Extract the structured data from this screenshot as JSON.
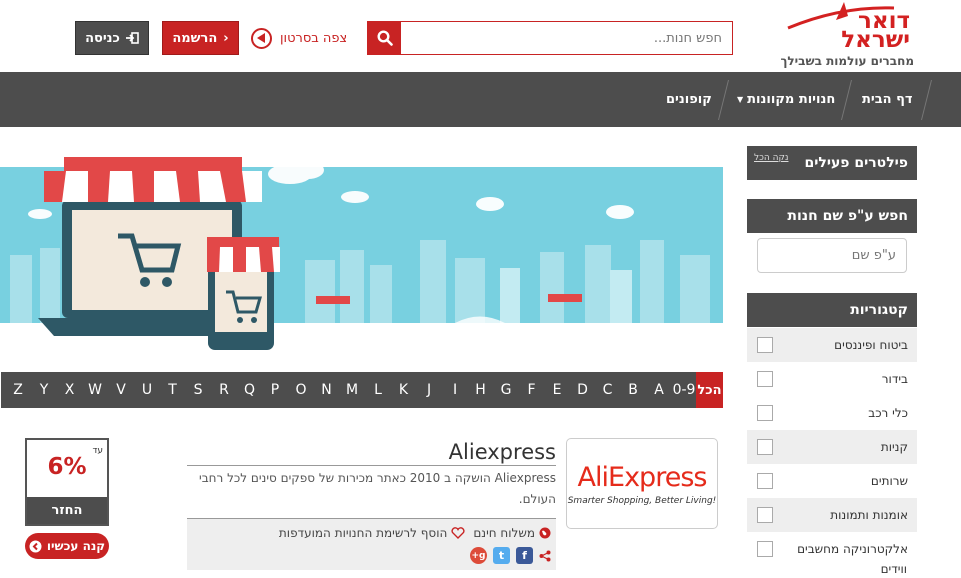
{
  "header": {
    "logo_line1": "דואר",
    "logo_line2": "ישראל",
    "logo_tagline": "מחברים עולמות בשבילך",
    "search_placeholder": "חפש חנות...",
    "video_link": "צפה בסרטון",
    "register_label": "הרשמה",
    "login_label": "כניסה"
  },
  "nav": {
    "items": [
      {
        "label": "דף הבית"
      },
      {
        "label": "חנויות מקוונות"
      },
      {
        "label": "קופונים"
      }
    ]
  },
  "alphabet": {
    "all_label": "הכל",
    "letters": [
      "0-9",
      "A",
      "B",
      "C",
      "D",
      "E",
      "F",
      "G",
      "H",
      "I",
      "J",
      "K",
      "L",
      "M",
      "N",
      "O",
      "P",
      "Q",
      "R",
      "S",
      "T",
      "U",
      "V",
      "W",
      "X",
      "Y",
      "Z"
    ]
  },
  "store": {
    "logo_name": "AliExpress",
    "logo_tagline": "Smarter Shopping, Better Living!",
    "title": "Aliexpress",
    "description": "Aliexpress הושקה ב 2010 כאתר מכירות של ספקים סינים לכל רחבי העולם.",
    "free_shipping": "משלוח חינם",
    "add_favorites": "הוסף לרשימת החנויות המועדפות",
    "cashback_prefix": "עד",
    "cashback_value": "6%",
    "cashback_label": "החזר",
    "buy_label": "קנה עכשיו"
  },
  "sidebar": {
    "active_filters_title": "פילטרים פעילים",
    "clear_all": "נקה הכל",
    "name_search_title": "חפש ע\"פ שם חנות",
    "name_search_placeholder": "ע\"פ שם",
    "categories_title": "קטגוריות",
    "categories": [
      {
        "label": "ביטוח ופיננסים"
      },
      {
        "label": "בידור"
      },
      {
        "label": "כלי רכב"
      },
      {
        "label": "קניות"
      },
      {
        "label": "שרותים"
      },
      {
        "label": "אומנות ותמונות"
      },
      {
        "label": "אלקטרוניקה מחשבים"
      }
    ],
    "categories_overflow": "ווידים"
  },
  "colors": {
    "brand_red": "#c82323",
    "dark_gray": "#4d4d4d",
    "banner_sky": "#78d0e0"
  }
}
